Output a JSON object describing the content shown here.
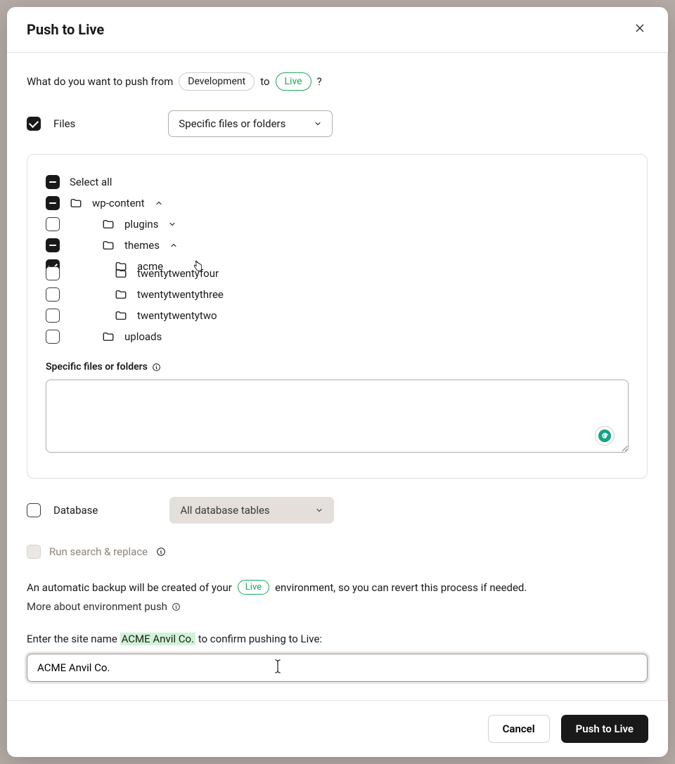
{
  "modal": {
    "title": "Push to Live",
    "question_prefix": "What do you want to push from",
    "from_env": "Development",
    "to_text": "to",
    "to_env": "Live",
    "question_suffix": "?"
  },
  "files": {
    "checkbox_label": "Files",
    "select_value": "Specific files or folders"
  },
  "tree": {
    "select_all": "Select all",
    "nodes": {
      "wp_content": "wp-content",
      "plugins": "plugins",
      "themes": "themes",
      "acme": "acme",
      "twentytwentyfour": "twentytwentyfour",
      "twentytwentythree": "twentytwentythree",
      "twentytwentytwo": "twentytwentytwo",
      "uploads": "uploads"
    },
    "specific_label": "Specific files or folders",
    "textarea_value": ""
  },
  "database": {
    "checkbox_label": "Database",
    "select_value": "All database tables"
  },
  "search_replace": {
    "label": "Run search & replace"
  },
  "backup": {
    "prefix": "An automatic backup will be created of your",
    "env": "Live",
    "suffix": "environment, so you can revert this process if needed.",
    "more_link": "More about environment push"
  },
  "confirm": {
    "prefix": "Enter the site name",
    "site_name": "ACME Anvil Co.",
    "suffix": "to confirm pushing to Live:",
    "input_value": "ACME Anvil Co."
  },
  "footer": {
    "cancel": "Cancel",
    "submit": "Push to Live"
  }
}
